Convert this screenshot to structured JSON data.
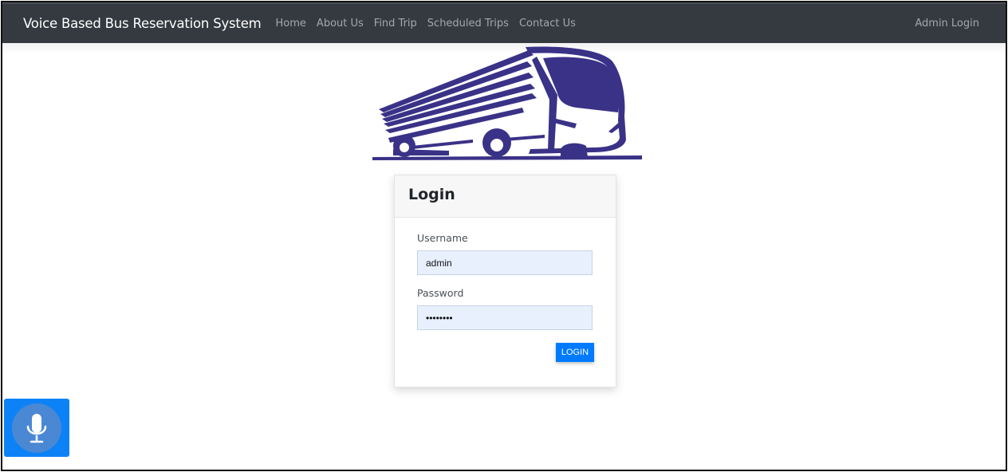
{
  "navbar": {
    "brand": "Voice Based Bus Reservation System",
    "links": [
      "Home",
      "About Us",
      "Find Trip",
      "Scheduled Trips",
      "Contact Us"
    ],
    "right_link": "Admin Login"
  },
  "logo": {
    "icon": "bus-logo",
    "color": "#3a3287"
  },
  "login": {
    "title": "Login",
    "username_label": "Username",
    "username_value": "admin",
    "password_label": "Password",
    "password_value": "admin123",
    "submit_label": "LOGIN"
  },
  "voice": {
    "icon": "microphone-icon"
  },
  "colors": {
    "navbar_bg": "#343a40",
    "primary": "#007bff",
    "input_bg": "#e8f0fe"
  }
}
